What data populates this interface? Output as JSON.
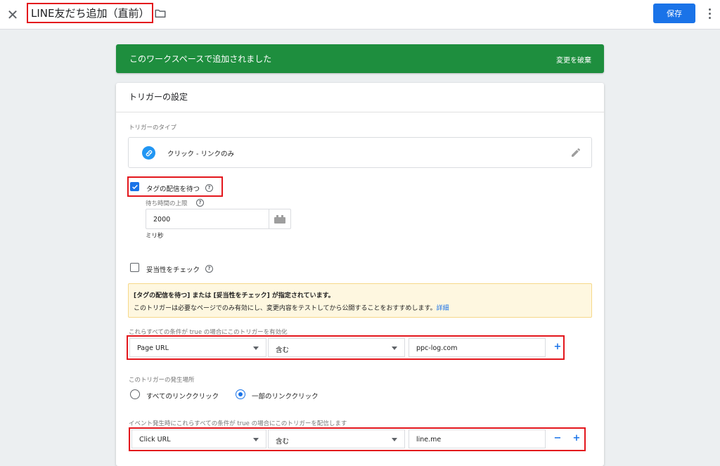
{
  "header": {
    "title": "LINE友だち追加（直前）",
    "save_label": "保存"
  },
  "banner": {
    "message": "このワークスペースで追加されました",
    "discard_label": "変更を破棄"
  },
  "trigger": {
    "section_title": "トリガーの設定",
    "type_label": "トリガーのタイプ",
    "type_name": "クリック - リンクのみ",
    "wait_for_tags": {
      "label": "タグの配信を待つ",
      "checked": true,
      "max_wait_label": "待ち時間の上限",
      "max_wait_value": "2000",
      "unit": "ミリ秒"
    },
    "check_validation": {
      "label": "妥当性をチェック",
      "checked": false
    },
    "info": {
      "heading": "[タグの配信を待つ] または [妥当性をチェック] が指定されています。",
      "body": "このトリガーは必要なページでのみ有効にし、変更内容をテストしてから公開することをおすすめします。",
      "link": "詳細"
    },
    "enable_conditions": {
      "label": "これらすべての条件が true の場合にこのトリガーを有効化",
      "variable": "Page URL",
      "operator": "含む",
      "value": "ppc-log.com"
    },
    "fire_on": {
      "label": "このトリガーの発生場所",
      "options": [
        "すべてのリンククリック",
        "一部のリンククリック"
      ],
      "selected": "一部のリンククリック"
    },
    "fire_conditions": {
      "label": "イベント発生時にこれらすべての条件が true の場合にこのトリガーを配信します",
      "variable": "Click URL",
      "operator": "含む",
      "value": "line.me"
    }
  },
  "colors": {
    "primary": "#1a73e8",
    "banner": "#1e8e3e",
    "highlight_frame": "#e3161c",
    "info_bg": "#fef7e0"
  },
  "icons": [
    "close-icon",
    "folder-icon",
    "more-vert-icon",
    "link-icon",
    "pencil-icon",
    "help-icon",
    "variable-icon",
    "add-icon",
    "remove-icon"
  ]
}
